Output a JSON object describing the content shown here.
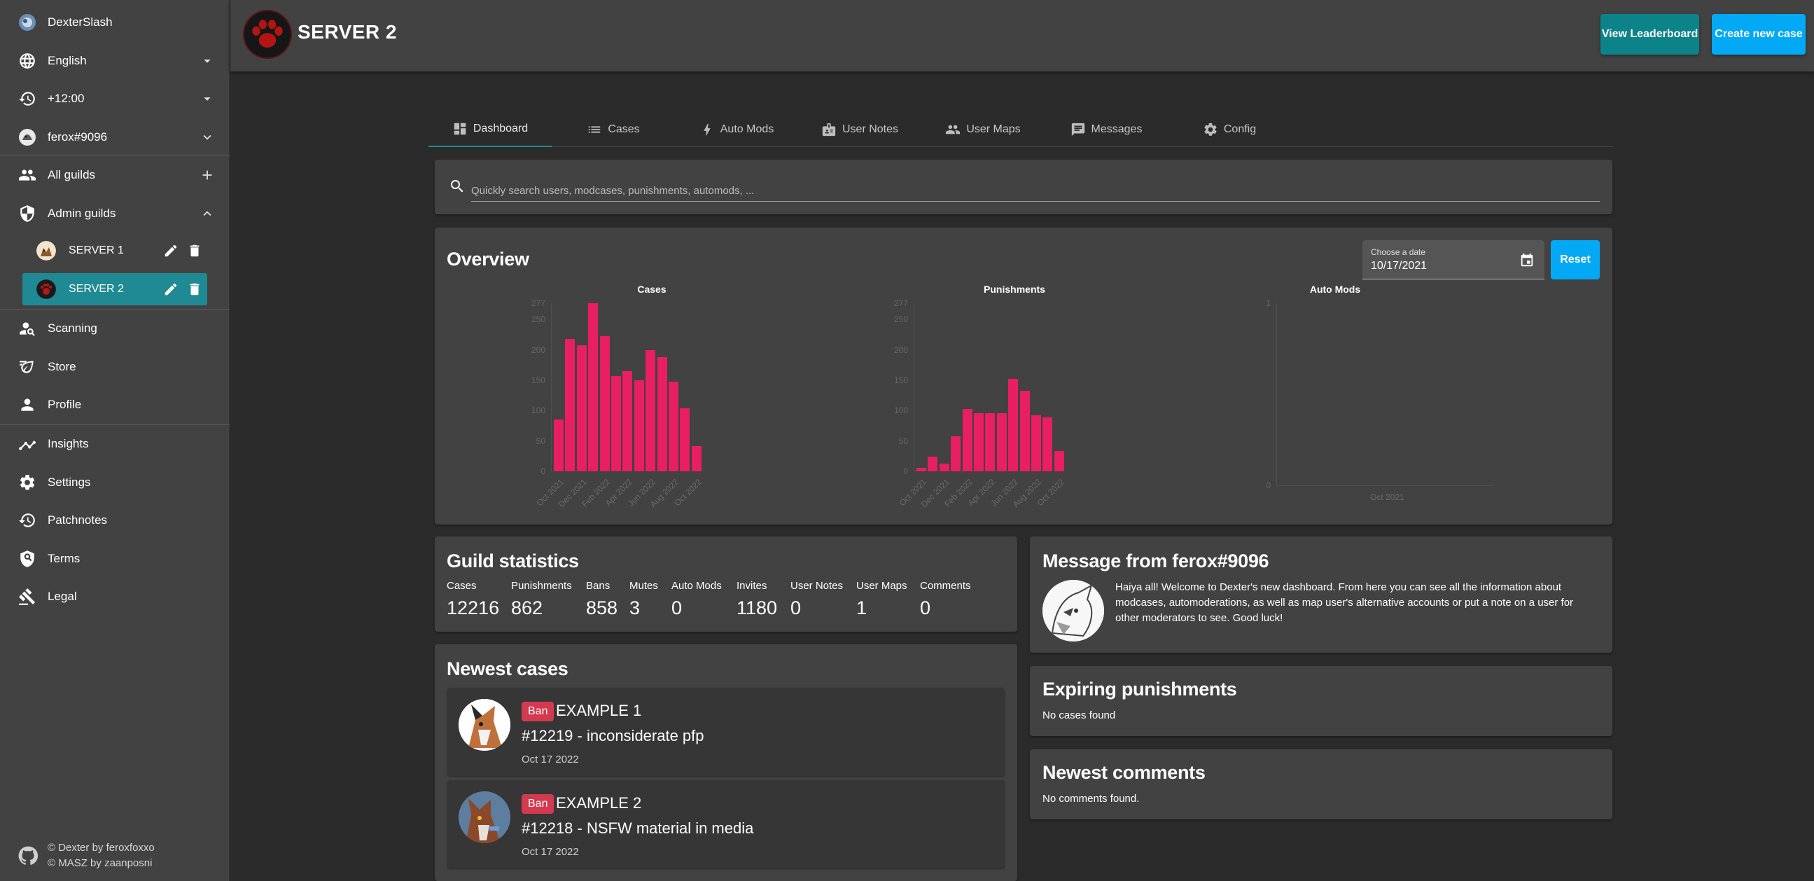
{
  "sidebar": {
    "user": "DexterSlash",
    "language": "English",
    "timezone": "+12:00",
    "account": "ferox#9096",
    "all_guilds": "All guilds",
    "admin_guilds": "Admin guilds",
    "guilds": [
      {
        "name": "SERVER 1",
        "active": false
      },
      {
        "name": "SERVER 2",
        "active": true
      }
    ],
    "items": [
      {
        "label": "Scanning",
        "icon": "scan-user-icon"
      },
      {
        "label": "Store",
        "icon": "leaf-icon"
      },
      {
        "label": "Profile",
        "icon": "person-icon"
      },
      {
        "label": "Insights",
        "icon": "trending-icon"
      },
      {
        "label": "Settings",
        "icon": "gear-icon"
      },
      {
        "label": "Patchnotes",
        "icon": "history-icon"
      },
      {
        "label": "Terms",
        "icon": "shield-search-icon"
      },
      {
        "label": "Legal",
        "icon": "gavel-icon"
      }
    ],
    "footer": {
      "line1": "© Dexter by feroxfoxxo",
      "line2": "© MASZ by zaanposni"
    }
  },
  "header": {
    "title": "SERVER 2",
    "leaderboard_button": "View Leaderboard",
    "create_case_button": "Create new case"
  },
  "tabs": [
    {
      "label": "Dashboard",
      "icon": "dashboard-icon",
      "active": true
    },
    {
      "label": "Cases",
      "icon": "list-icon",
      "active": false
    },
    {
      "label": "Auto Mods",
      "icon": "bolt-icon",
      "active": false
    },
    {
      "label": "User Notes",
      "icon": "id-card-icon",
      "active": false
    },
    {
      "label": "User Maps",
      "icon": "people-icon",
      "active": false
    },
    {
      "label": "Messages",
      "icon": "message-icon",
      "active": false
    },
    {
      "label": "Config",
      "icon": "gear-icon",
      "active": false
    }
  ],
  "search": {
    "placeholder": "Quickly search users, modcases, punishments, automods, ..."
  },
  "overview": {
    "title": "Overview",
    "date_label": "Choose a date",
    "date_value": "10/17/2021",
    "reset_button": "Reset"
  },
  "chart_data": [
    {
      "type": "bar",
      "title": "Cases",
      "categories": [
        "Oct 2021",
        "Nov 2021",
        "Dec 2021",
        "Jan 2022",
        "Feb 2022",
        "Mar 2022",
        "Apr 2022",
        "May 2022",
        "Jun 2022",
        "Jul 2022",
        "Aug 2022",
        "Sep 2022",
        "Oct 2022"
      ],
      "x_tick_labels": [
        "Oct 2021",
        "Dec 2021",
        "Feb 2022",
        "Apr 2022",
        "Jun 2022",
        "Aug 2022",
        "Oct 2022"
      ],
      "values": [
        85,
        218,
        208,
        277,
        223,
        157,
        165,
        150,
        200,
        188,
        148,
        104,
        42
      ],
      "y_ticks": [
        0,
        50,
        100,
        150,
        200,
        250,
        277
      ],
      "ylim": [
        0,
        277
      ],
      "color": "#e91e63"
    },
    {
      "type": "bar",
      "title": "Punishments",
      "categories": [
        "Oct 2021",
        "Nov 2021",
        "Dec 2021",
        "Jan 2022",
        "Feb 2022",
        "Mar 2022",
        "Apr 2022",
        "May 2022",
        "Jun 2022",
        "Jul 2022",
        "Aug 2022",
        "Sep 2022",
        "Oct 2022"
      ],
      "x_tick_labels": [
        "Oct 2021",
        "Dec 2021",
        "Feb 2022",
        "Apr 2022",
        "Jun 2022",
        "Aug 2022",
        "Oct 2022"
      ],
      "values": [
        6,
        24,
        13,
        58,
        103,
        96,
        96,
        96,
        152,
        133,
        92,
        89,
        34
      ],
      "y_ticks": [
        0,
        50,
        100,
        150,
        200,
        250,
        277
      ],
      "ylim": [
        0,
        277
      ],
      "color": "#e91e63"
    },
    {
      "type": "bar",
      "title": "Auto Mods",
      "categories": [
        "Oct 2021"
      ],
      "x_tick_labels": [
        "Oct 2021"
      ],
      "values": [
        0
      ],
      "y_ticks": [
        0,
        1
      ],
      "ylim": [
        0,
        1
      ],
      "color": "#e91e63"
    }
  ],
  "stats": {
    "title": "Guild statistics",
    "items": [
      {
        "label": "Cases",
        "value": "12216"
      },
      {
        "label": "Punishments",
        "value": "862"
      },
      {
        "label": "Bans",
        "value": "858"
      },
      {
        "label": "Mutes",
        "value": "3"
      },
      {
        "label": "Auto Mods",
        "value": "0"
      },
      {
        "label": "Invites",
        "value": "1180"
      },
      {
        "label": "User Notes",
        "value": "0"
      },
      {
        "label": "User Maps",
        "value": "1"
      },
      {
        "label": "Comments",
        "value": "0"
      }
    ]
  },
  "newest_cases": {
    "title": "Newest cases",
    "items": [
      {
        "badge": "Ban",
        "name": "EXAMPLE 1",
        "title": "#12219 - inconsiderate pfp",
        "date": "Oct 17 2022"
      },
      {
        "badge": "Ban",
        "name": "EXAMPLE 2",
        "title": "#12218 - NSFW material in media",
        "date": "Oct 17 2022"
      }
    ]
  },
  "message": {
    "title": "Message from ferox#9096",
    "text": "Haiya all! Welcome to Dexter's new dashboard. From here you can see all the information about modcases, automoderations, as well as map user's alternative accounts or put a note on a user for other moderators to see. Good luck!"
  },
  "expiring": {
    "title": "Expiring punishments",
    "empty": "No cases found"
  },
  "comments": {
    "title": "Newest comments",
    "empty": "No comments found."
  }
}
